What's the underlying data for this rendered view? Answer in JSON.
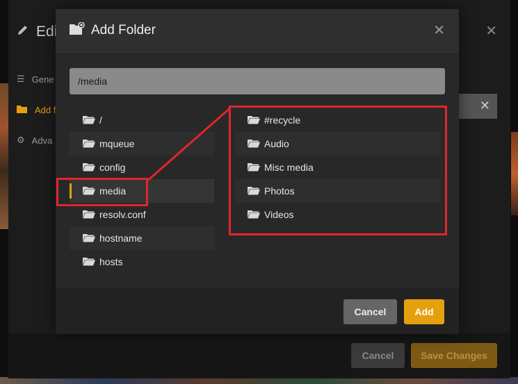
{
  "background": {
    "edit_title": "Edi",
    "nav": [
      {
        "label": "Gene",
        "icon": "list-icon"
      },
      {
        "label": "Add f",
        "icon": "folder-icon",
        "active": true
      },
      {
        "label": "Adva",
        "icon": "gear-icon"
      }
    ],
    "cancel_label": "Cancel",
    "save_label": "Save Changes"
  },
  "modal": {
    "title": "Add Folder",
    "path_value": "/media",
    "left_items": [
      "/",
      "mqueue",
      "config",
      "media",
      "resolv.conf",
      "hostname",
      "hosts"
    ],
    "selected_index": 3,
    "right_items": [
      "#recycle",
      "Audio",
      "Misc media",
      "Photos",
      "Videos"
    ],
    "cancel_label": "Cancel",
    "add_label": "Add"
  },
  "colors": {
    "accent": "#e5a00d",
    "annotation": "#e0262a"
  }
}
